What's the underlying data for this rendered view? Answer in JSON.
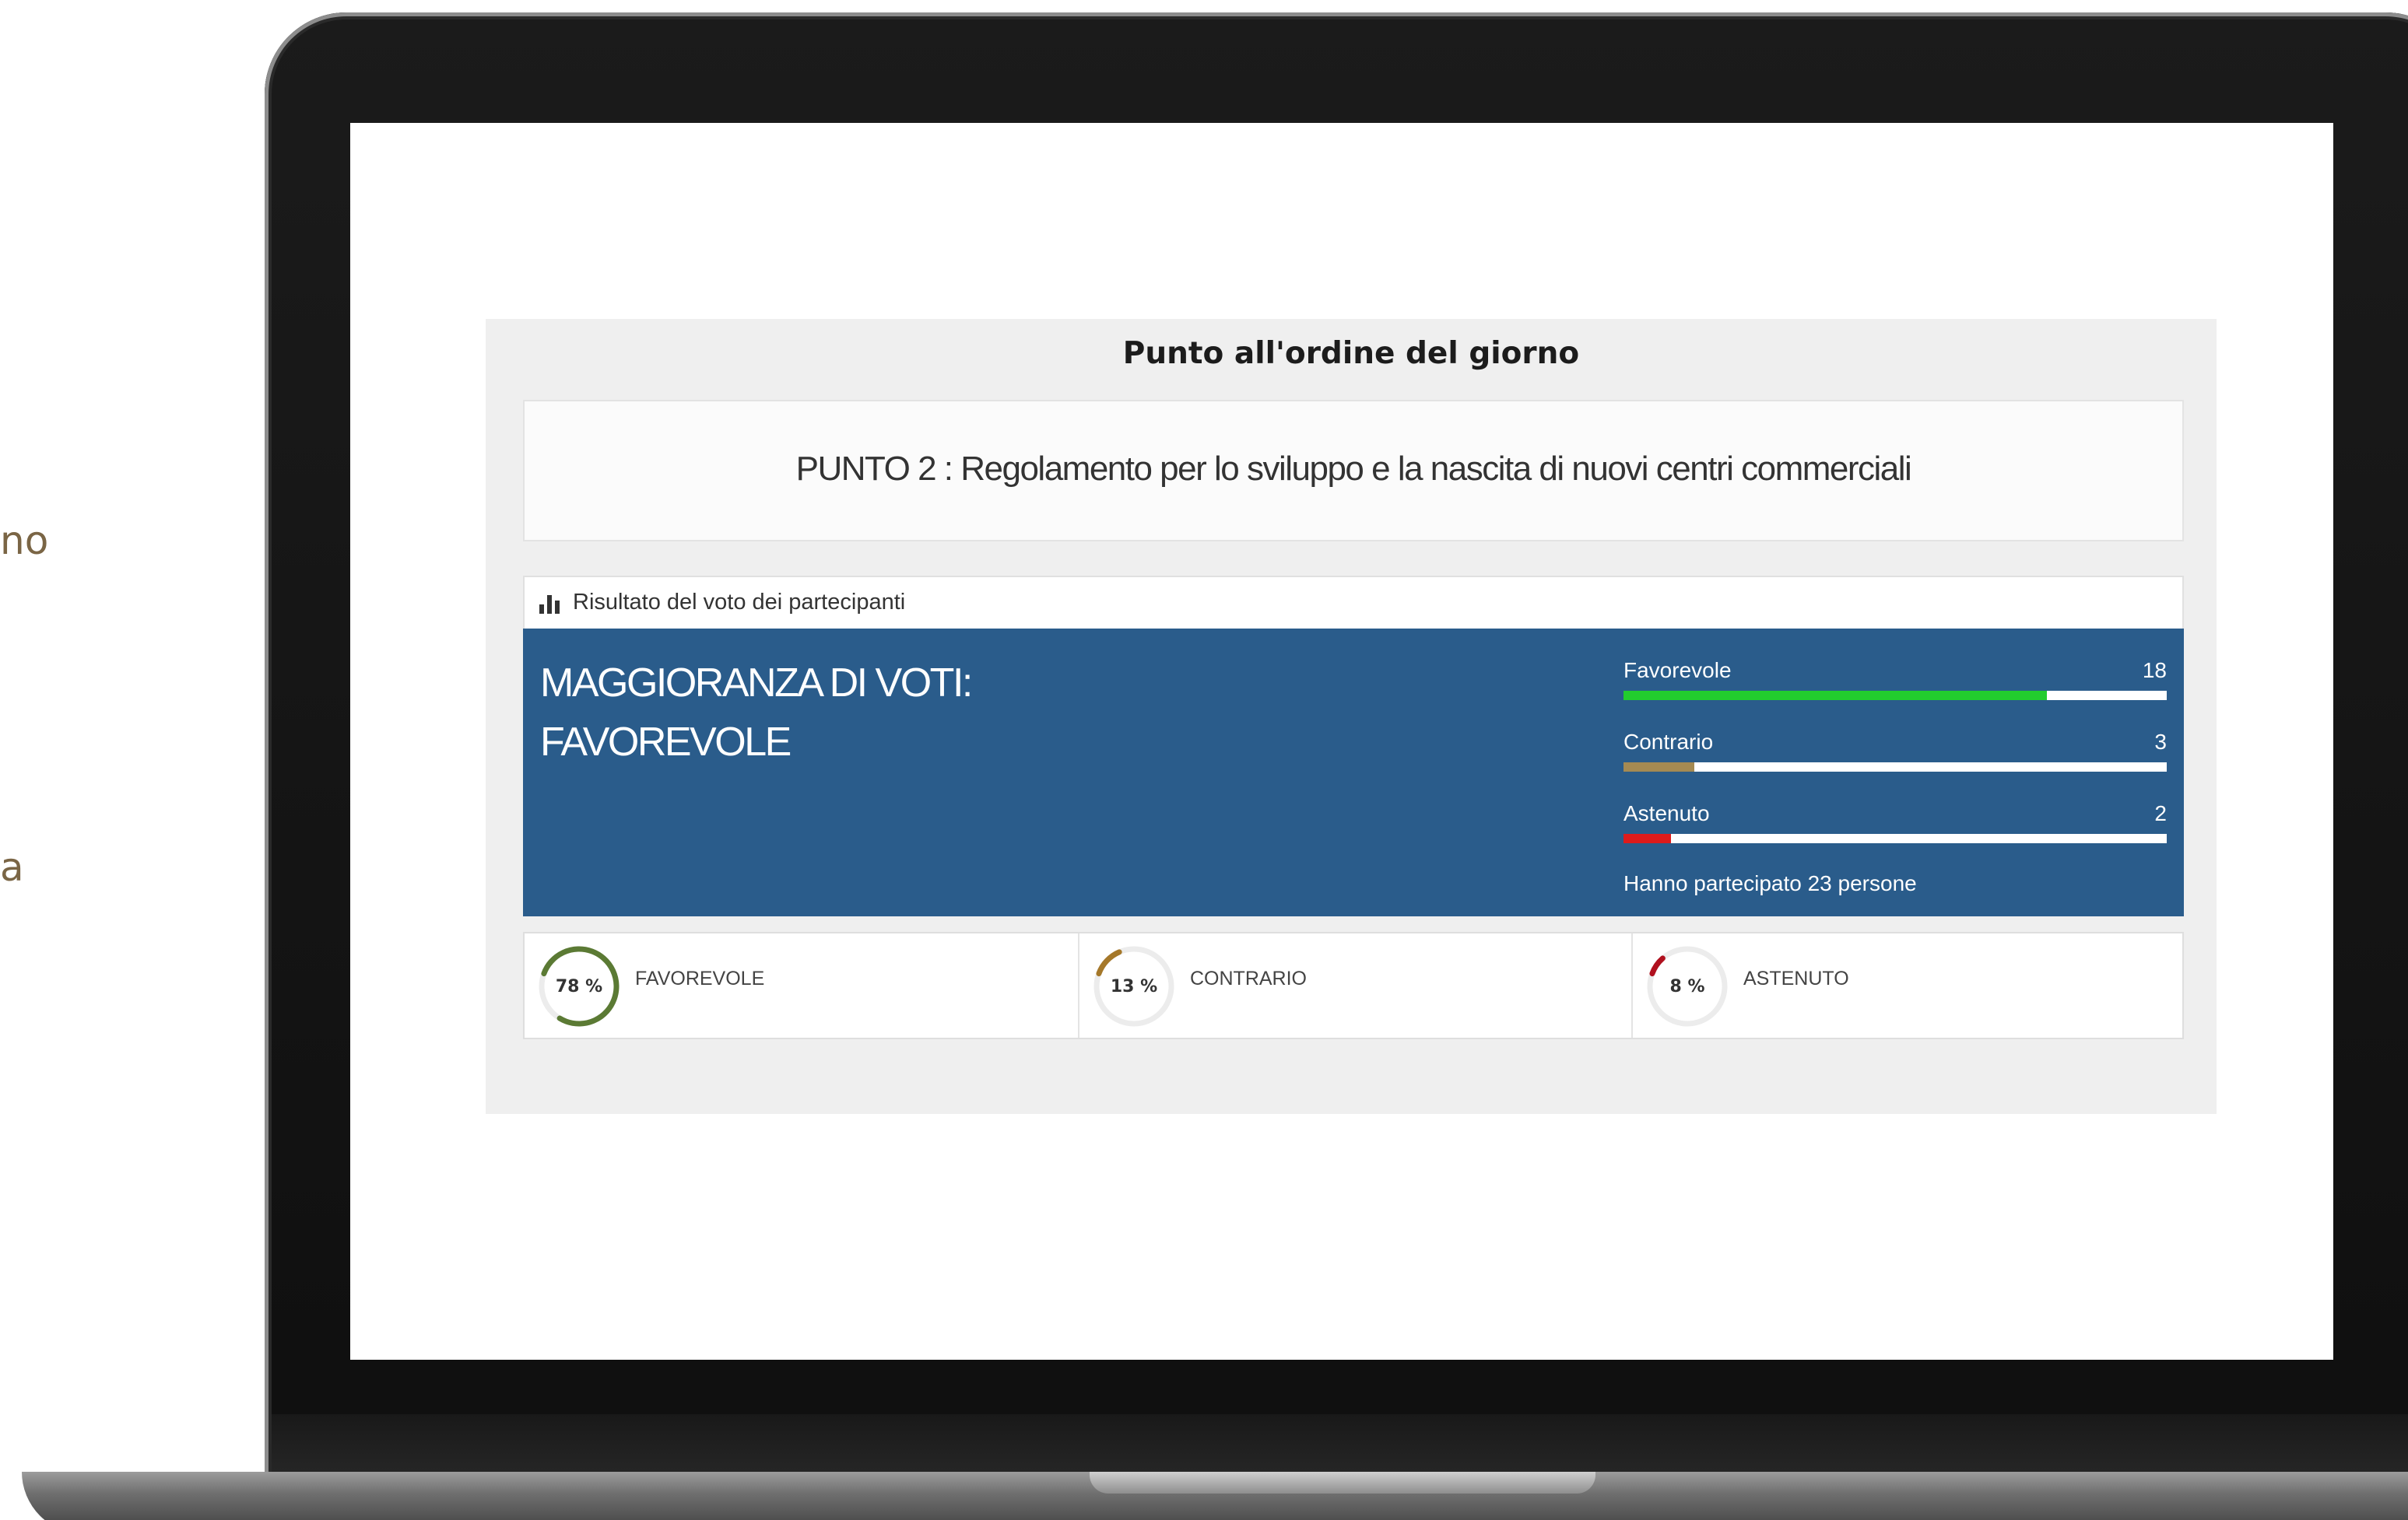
{
  "background_text": {
    "line1": "no",
    "line2": "a"
  },
  "panel": {
    "title": "Punto all'ordine del giorno",
    "agenda_item": "PUNTO 2 : Regolamento per lo sviluppo e la nascita di nuovi centri commerciali"
  },
  "results": {
    "header_icon": "bar-chart-icon",
    "header_label": "Risultato del voto dei partecipanti",
    "majority_line1": "MAGGIORANZA DI VOTI:",
    "majority_line2": "FAVOREVOLE",
    "votes": [
      {
        "label": "Favorevole",
        "count": "18",
        "fraction": 0.78,
        "color": "#22cc2e"
      },
      {
        "label": "Contrario",
        "count": "3",
        "fraction": 0.13,
        "color": "#a58a52"
      },
      {
        "label": "Astenuto",
        "count": "2",
        "fraction": 0.087,
        "color": "#dd1b1b"
      }
    ],
    "participants": "Hanno partecipato 23 persone"
  },
  "stats": [
    {
      "percent_label": "78 %",
      "fraction": 0.78,
      "label": "FAVOREVOLE",
      "color": "#5b7a34"
    },
    {
      "percent_label": "13 %",
      "fraction": 0.13,
      "label": "CONTRARIO",
      "color": "#a5782a"
    },
    {
      "percent_label": "8 %",
      "fraction": 0.08,
      "label": "ASTENUTO",
      "color": "#b0101e"
    }
  ],
  "colors": {
    "banner": "#2a5c8b",
    "panel_bg": "#efefef",
    "ring_track": "#ececec"
  }
}
